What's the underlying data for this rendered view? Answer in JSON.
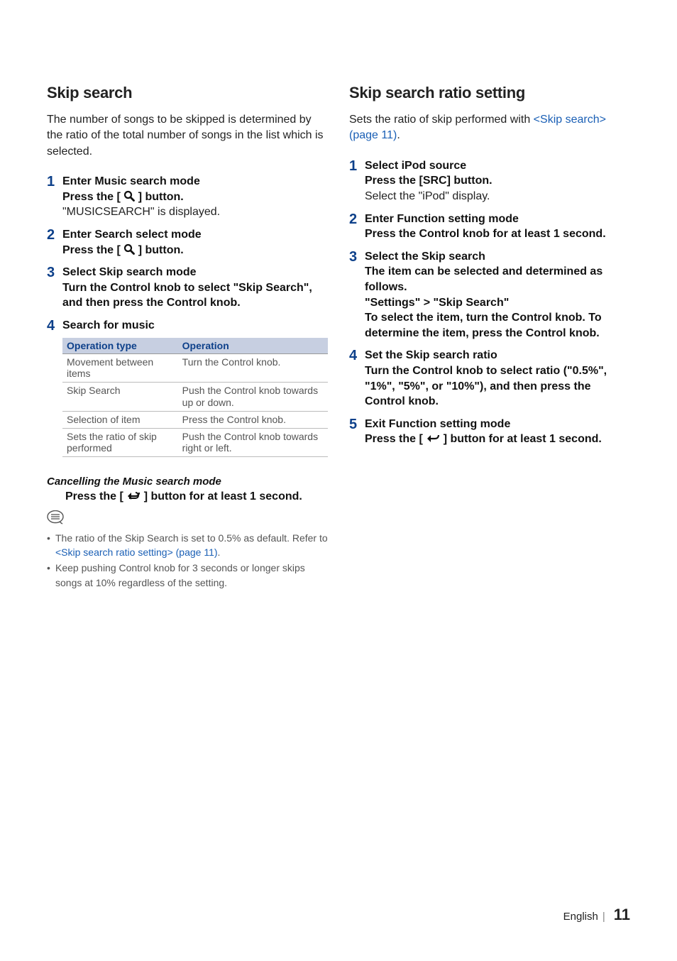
{
  "left": {
    "heading": "Skip search",
    "intro": "The number of songs to be skipped is determined by the ratio of the total number of songs in the list which is selected.",
    "steps": [
      {
        "num": "1",
        "title": "Enter Music search mode",
        "bold_prefix": "Press the [ ",
        "bold_suffix": " ] button.",
        "normal": "\"MUSICSEARCH\" is displayed."
      },
      {
        "num": "2",
        "title": "Enter Search select mode",
        "bold_prefix": "Press the [ ",
        "bold_suffix": " ] button."
      },
      {
        "num": "3",
        "title": "Select Skip search mode",
        "bold": "Turn the Control knob to select \"Skip Search\", and then press the Control knob."
      },
      {
        "num": "4",
        "title": "Search for music"
      }
    ],
    "table": {
      "head": [
        "Operation type",
        "Operation"
      ],
      "rows": [
        [
          "Movement between items",
          "Turn the Control knob."
        ],
        [
          "Skip Search",
          "Push the Control knob towards up or down."
        ],
        [
          "Selection of item",
          "Press the Control knob."
        ],
        [
          "Sets the ratio of skip performed",
          "Push the Control knob towards right or left."
        ]
      ]
    },
    "cancel": {
      "title": "Cancelling the Music search mode",
      "body_prefix": "Press the [ ",
      "body_suffix": " ] button for at least 1 second."
    },
    "notes": [
      {
        "pre": "The ratio of the Skip Search is set to 0.5% as default. Refer to ",
        "link": "<Skip search ratio setting> (page 11)",
        "post": "."
      },
      {
        "pre": "Keep pushing Control knob for 3 seconds or longer skips songs at 10% regardless of the setting.",
        "link": "",
        "post": ""
      }
    ]
  },
  "right": {
    "heading": "Skip search ratio setting",
    "intro_pre": "Sets the ratio of skip performed with ",
    "intro_link": "<Skip search> (page 11)",
    "intro_post": ".",
    "steps": [
      {
        "num": "1",
        "title": "Select iPod source",
        "bold": "Press the [SRC] button.",
        "normal": "Select the \"iPod\" display."
      },
      {
        "num": "2",
        "title": "Enter Function setting mode",
        "bold": "Press the Control knob for at least 1 second."
      },
      {
        "num": "3",
        "title": "Select the Skip search",
        "bold1": "The item can be selected and determined as follows.",
        "bold2": "\"Settings\" > \"Skip Search\"",
        "bold3": "To select the item, turn the Control knob. To determine the item, press the Control knob."
      },
      {
        "num": "4",
        "title": "Set the Skip search ratio",
        "bold": "Turn the Control knob to select ratio (\"0.5%\", \"1%\", \"5%\", or \"10%\"), and then press the Control knob."
      },
      {
        "num": "5",
        "title": "Exit Function setting mode",
        "bold_prefix": "Press the [ ",
        "bold_suffix": " ] button for at least 1 second."
      }
    ]
  },
  "footer": {
    "lang": "English",
    "page": "11"
  }
}
